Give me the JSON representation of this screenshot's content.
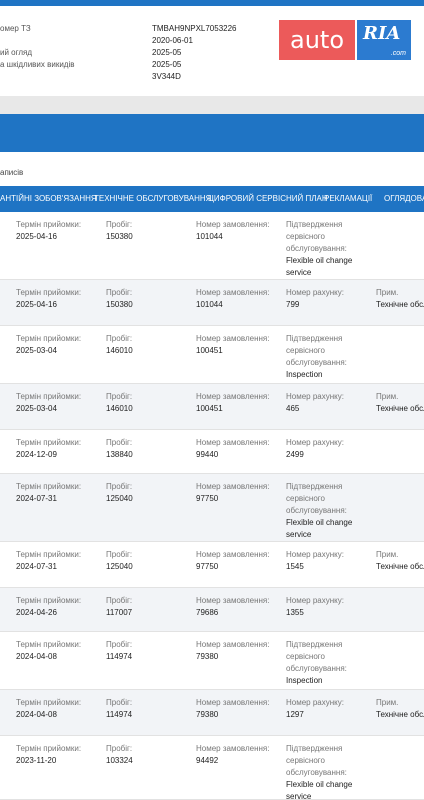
{
  "vehicle": {
    "rows": [
      {
        "label": "омер ТЗ",
        "value": "TMBAH9NPXL7053226"
      },
      {
        "label": "",
        "value": "2020-06-01"
      },
      {
        "label": "ий огляд",
        "value": "2025-05"
      },
      {
        "label": "а шкідливих викидів",
        "value": "2025-05"
      },
      {
        "label": "",
        "value": "3V344D"
      }
    ]
  },
  "logo": {
    "auto": "auto",
    "ria": "RIA",
    "com": ".com"
  },
  "records_label": "аписів",
  "tabs": [
    "АНТІЙНІ ЗОБОВ'ЯЗАННЯ",
    "ТЕХНІЧНЕ ОБСЛУГОВУВАННЯ",
    "ЦИФРОВИЙ СЕРВІСНИЙ ПЛАН",
    "РЕКЛАМАЦІЇ",
    "ОГЛЯДОВА К"
  ],
  "records": [
    {
      "c1l": "Термін прийомки:",
      "c1v": "2025-04-16",
      "c2l": "Пробіг:",
      "c2v": "150380",
      "c3l": "Номер замовлення:",
      "c3v": "101044",
      "c4l": "Підтвердження сервісного обслуговування:",
      "c4v": "Flexible oil change service",
      "c5l": "",
      "c5v": ""
    },
    {
      "c1l": "Термін прийомки:",
      "c1v": "2025-04-16",
      "c2l": "Пробіг:",
      "c2v": "150380",
      "c3l": "Номер замовлення:",
      "c3v": "101044",
      "c4l": "Номер рахунку:",
      "c4v": "799",
      "c5l": "Прим.",
      "c5v": "Технічне обслуговува"
    },
    {
      "c1l": "Термін прийомки:",
      "c1v": "2025-03-04",
      "c2l": "Пробіг:",
      "c2v": "146010",
      "c3l": "Номер замовлення:",
      "c3v": "100451",
      "c4l": "Підтвердження сервісного обслуговування:",
      "c4v": "Inspection",
      "c5l": "",
      "c5v": ""
    },
    {
      "c1l": "Термін прийомки:",
      "c1v": "2025-03-04",
      "c2l": "Пробіг:",
      "c2v": "146010",
      "c3l": "Номер замовлення:",
      "c3v": "100451",
      "c4l": "Номер рахунку:",
      "c4v": "465",
      "c5l": "Прим.",
      "c5v": "Технічне обслуговува"
    },
    {
      "c1l": "Термін прийомки:",
      "c1v": "2024-12-09",
      "c2l": "Пробіг:",
      "c2v": "138840",
      "c3l": "Номер замовлення:",
      "c3v": "99440",
      "c4l": "Номер рахунку:",
      "c4v": "2499",
      "c5l": "",
      "c5v": ""
    },
    {
      "c1l": "Термін прийомки:",
      "c1v": "2024-07-31",
      "c2l": "Пробіг:",
      "c2v": "125040",
      "c3l": "Номер замовлення:",
      "c3v": "97750",
      "c4l": "Підтвердження сервісного обслуговування:",
      "c4v": "Flexible oil change service",
      "c5l": "",
      "c5v": ""
    },
    {
      "c1l": "Термін прийомки:",
      "c1v": "2024-07-31",
      "c2l": "Пробіг:",
      "c2v": "125040",
      "c3l": "Номер замовлення:",
      "c3v": "97750",
      "c4l": "Номер рахунку:",
      "c4v": "1545",
      "c5l": "Прим.",
      "c5v": "Технічне обслуговува"
    },
    {
      "c1l": "Термін прийомки:",
      "c1v": "2024-04-26",
      "c2l": "Пробіг:",
      "c2v": "117007",
      "c3l": "Номер замовлення:",
      "c3v": "79686",
      "c4l": "Номер рахунку:",
      "c4v": "1355",
      "c5l": "",
      "c5v": ""
    },
    {
      "c1l": "Термін прийомки:",
      "c1v": "2024-04-08",
      "c2l": "Пробіг:",
      "c2v": "114974",
      "c3l": "Номер замовлення:",
      "c3v": "79380",
      "c4l": "Підтвердження сервісного обслуговування:",
      "c4v": "Inspection",
      "c5l": "",
      "c5v": ""
    },
    {
      "c1l": "Термін прийомки:",
      "c1v": "2024-04-08",
      "c2l": "Пробіг:",
      "c2v": "114974",
      "c3l": "Номер замовлення:",
      "c3v": "79380",
      "c4l": "Номер рахунку:",
      "c4v": "1297",
      "c5l": "Прим.",
      "c5v": "Технічне обслуговува"
    },
    {
      "c1l": "Термін прийомки:",
      "c1v": "2023-11-20",
      "c2l": "Пробіг:",
      "c2v": "103324",
      "c3l": "Номер замовлення:",
      "c3v": "94492",
      "c4l": "Підтвердження сервісного обслуговування:",
      "c4v": "Flexible oil change service",
      "c5l": "",
      "c5v": ""
    }
  ]
}
